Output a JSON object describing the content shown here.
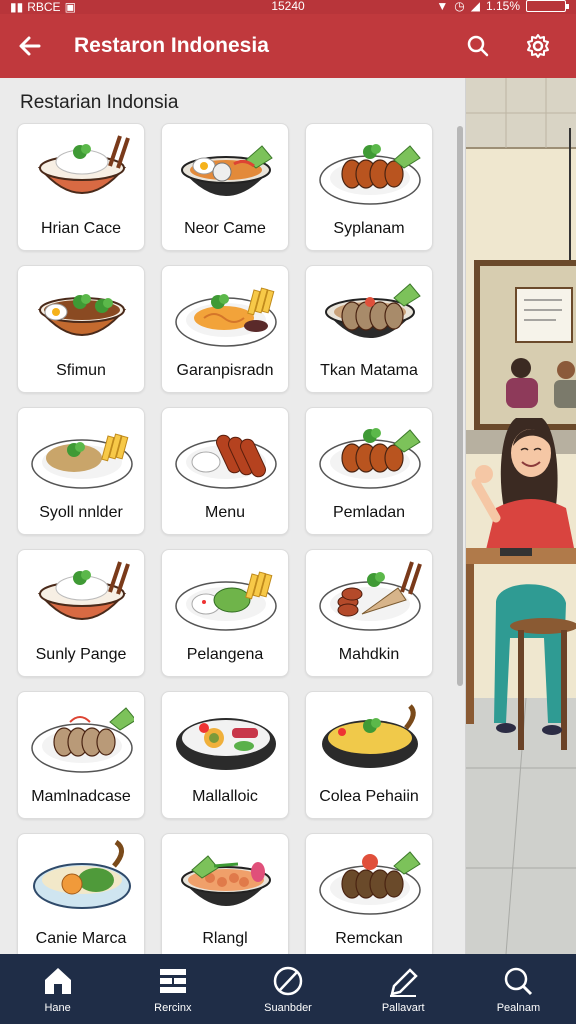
{
  "status": {
    "left": "RBCE",
    "time": "15240",
    "battery": "1.15%"
  },
  "app_bar": {
    "title": "Restaron Indonesia",
    "icons": [
      "back-arrow-icon",
      "search-icon",
      "settings-icon"
    ]
  },
  "section_title": "Restarian Indonsia",
  "menu": [
    {
      "label": "Hrian Cace",
      "dish": "rice-bowl"
    },
    {
      "label": "Neor Came",
      "dish": "mixed-plate"
    },
    {
      "label": "Syplanam",
      "dish": "satay-plate"
    },
    {
      "label": "Sfimun",
      "dish": "curry-egg-bowl"
    },
    {
      "label": "Garanpisradn",
      "dish": "noodle-plate"
    },
    {
      "label": "Tkan Matama",
      "dish": "beef-bowl"
    },
    {
      "label": "Syoll nnlder",
      "dish": "soup-plate"
    },
    {
      "label": "Menu",
      "dish": "sausage-plate"
    },
    {
      "label": "Pemladan",
      "dish": "satay-plate"
    },
    {
      "label": "Sunly Pange",
      "dish": "rice-bowl"
    },
    {
      "label": "Pelangena",
      "dish": "veg-rice-plate"
    },
    {
      "label": "Mahdkin",
      "dish": "grill-plate"
    },
    {
      "label": "Mamlnadcase",
      "dish": "beef-plate"
    },
    {
      "label": "Mallalloic",
      "dish": "salad-bowl"
    },
    {
      "label": "Colea Pehaiin",
      "dish": "fried-rice-pan"
    },
    {
      "label": "Canie Marca",
      "dish": "veg-bowl"
    },
    {
      "label": "Rlangl",
      "dish": "mix-bowl"
    },
    {
      "label": "Remckan",
      "dish": "rendang-plate"
    }
  ],
  "bottom_nav": [
    {
      "label": "Hane",
      "icon": "home-icon"
    },
    {
      "label": "Rercinx",
      "icon": "grid-icon"
    },
    {
      "label": "Suanbder",
      "icon": "slash-circle-icon"
    },
    {
      "label": "Pallavart",
      "icon": "pen-icon"
    },
    {
      "label": "Pealnam",
      "icon": "search-icon"
    }
  ]
}
